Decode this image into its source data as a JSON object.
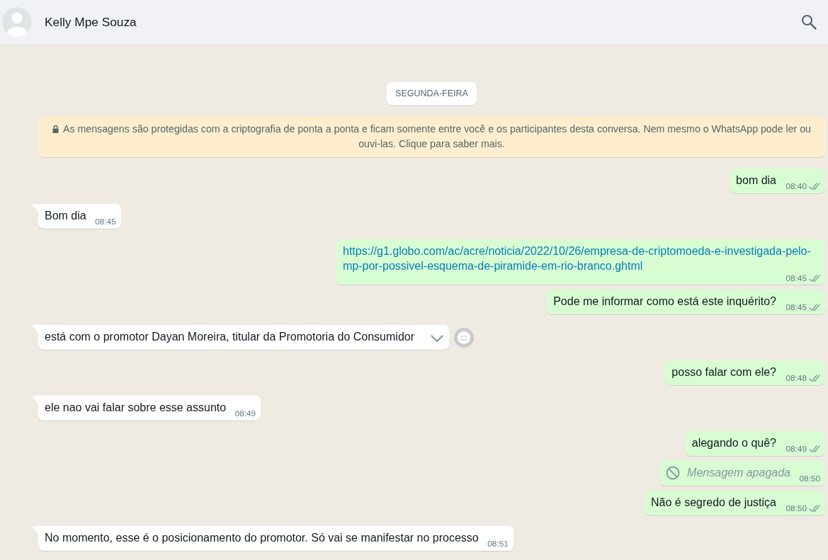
{
  "header": {
    "contact_name": "Kelly Mpe Souza"
  },
  "date_chip": "SEGUNDA-FEIRA",
  "encryption_notice": "As mensagens são protegidas com a criptografia de ponta a ponta e ficam somente entre você e os participantes desta conversa. Nem mesmo o WhatsApp pode ler ou ouvi-las. Clique para saber mais.",
  "messages": [
    {
      "outgoing": true,
      "kind": "text",
      "text": "bom dia",
      "time": "08:40",
      "read": false,
      "tail": false,
      "hovered": false
    },
    {
      "outgoing": false,
      "kind": "text",
      "text": "Bom dia",
      "time": "08:45",
      "tail": true,
      "hovered": false
    },
    {
      "outgoing": true,
      "kind": "link",
      "text": "https://g1.globo.com/ac/acre/noticia/2022/10/26/empresa-de-criptomoeda-e-investigada-pelo-mp-por-possivel-esquema-de-piramide-em-rio-branco.ghtml",
      "time": "08:45",
      "read": false,
      "tail": false,
      "hovered": false
    },
    {
      "outgoing": true,
      "kind": "text",
      "text": "Pode me informar como está este inquérito?",
      "time": "08:45",
      "read": false,
      "tail": false,
      "hovered": false
    },
    {
      "outgoing": false,
      "kind": "text",
      "text": "está com o promotor Dayan Moreira, titular da Promotoria do Consumidor",
      "tail": true,
      "hovered": true
    },
    {
      "outgoing": true,
      "kind": "text",
      "text": "posso falar com ele?",
      "time": "08:48",
      "read": false,
      "tail": false,
      "hovered": false
    },
    {
      "outgoing": false,
      "kind": "text",
      "text": "ele nao vai falar sobre esse assunto",
      "time": "08:49",
      "tail": true,
      "hovered": false
    },
    {
      "outgoing": true,
      "kind": "text",
      "text": "alegando o quê?",
      "time": "08:49",
      "read": false,
      "tail": false,
      "hovered": false
    },
    {
      "outgoing": true,
      "kind": "deleted",
      "text": "Mensagem apagada",
      "time": "08:50",
      "tail": false,
      "hovered": false
    },
    {
      "outgoing": true,
      "kind": "text",
      "text": "Não é segredo de justiça",
      "time": "08:50",
      "read": false,
      "tail": false,
      "hovered": false
    },
    {
      "outgoing": false,
      "kind": "text",
      "text": "No momento, esse é o posicionamento do promotor. Só vai se manifestar no processo",
      "time": "08:51",
      "tail": true,
      "hovered": false
    }
  ]
}
